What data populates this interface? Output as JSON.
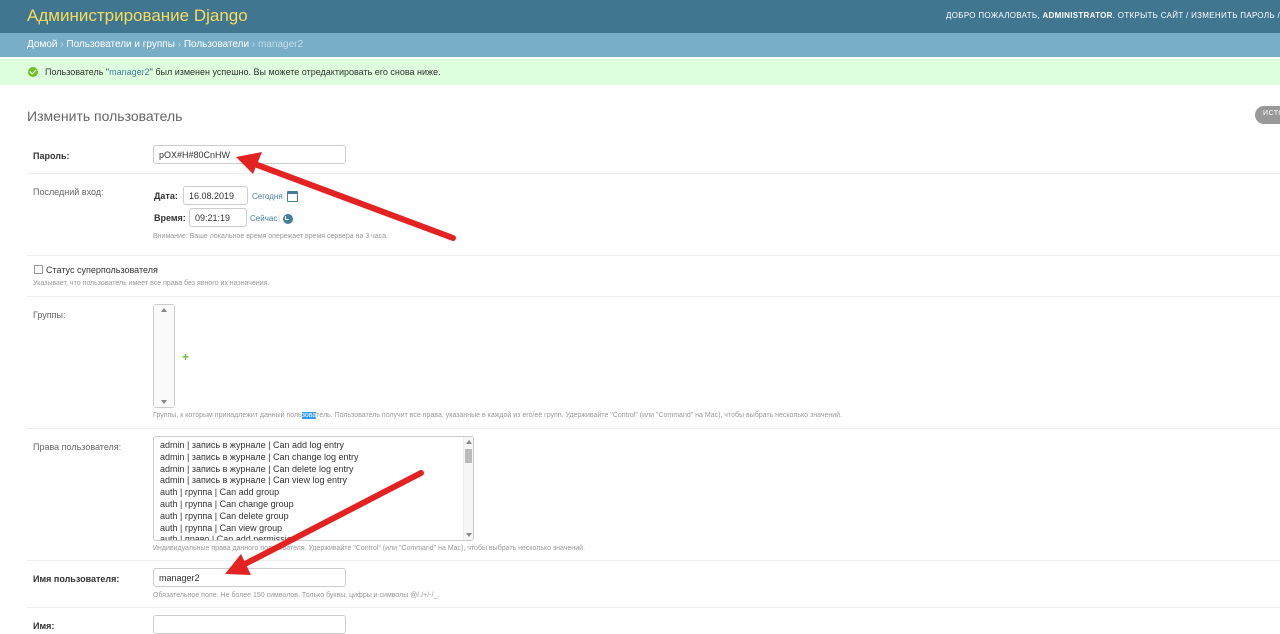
{
  "header": {
    "brand": "Администрирование Django",
    "welcome": "ДОБРО ПОЖАЛОВАТЬ,",
    "username": "ADMINISTRATOR",
    "tools": ". ОТКРЫТЬ САЙТ / ИЗМЕНИТЬ ПАРОЛЬ /"
  },
  "breadcrumbs": {
    "home": "Домой",
    "app": "Пользователи и группы",
    "model": "Пользователи",
    "current": "manager2",
    "sep": "›"
  },
  "message": {
    "prefix": "Пользователь \"",
    "link": "manager2",
    "suffix": "\" был изменен успешно. Вы можете отредактировать его снова ниже."
  },
  "page": {
    "title": "Изменить пользователь",
    "history_button": "ИСТО"
  },
  "form": {
    "password": {
      "label": "Пароль:",
      "value": "pOX#H#80CnHW"
    },
    "last_login": {
      "label": "Последний вход:",
      "date_label": "Дата:",
      "date_value": "16.08.2019",
      "today_link": "Сегодня",
      "time_label": "Время:",
      "time_value": "09:21:19",
      "now_link": "Сейчас",
      "sep": "|",
      "help": "Внимание: Ваше локальное время опережает время сервера на 3 часа."
    },
    "superuser": {
      "label": "Статус суперпользователя",
      "help": "Указывает, что пользователь имеет все права без явного их назначения."
    },
    "groups": {
      "label": "Группы:",
      "help_before": "Группы, к которым принадлежит данный поль",
      "help_highlight": "зова",
      "help_after": "тель. Пользователь получит все права, указанные в каждой из его/её групп. Удерживайте \"Control\" (или \"Command\" на Mac), чтобы выбрать несколько значений."
    },
    "permissions": {
      "label": "Права пользователя:",
      "options": [
        "admin | запись в журнале | Can add log entry",
        "admin | запись в журнале | Can change log entry",
        "admin | запись в журнале | Can delete log entry",
        "admin | запись в журнале | Can view log entry",
        "auth | группа | Can add group",
        "auth | группа | Can change group",
        "auth | группа | Can delete group",
        "auth | группа | Can view group",
        "auth | право | Can add permission"
      ],
      "help": "Индивидуальные права данного пользователя. Удерживайте \"Control\" (или \"Command\" на Mac), чтобы выбрать несколько значений."
    },
    "username": {
      "label": "Имя пользователя:",
      "value": "manager2",
      "help": "Обязательное поле. Не более 150 символов. Только буквы, цифры и символы @/./+/-/_."
    },
    "first_name": {
      "label": "Имя:",
      "value": ""
    }
  },
  "icons": {
    "success": "checkmark-circle-icon",
    "calendar": "calendar-icon",
    "clock": "clock-icon",
    "add": "plus-icon",
    "annotation": "red-arrow"
  },
  "colors": {
    "header_bg": "#417690",
    "brand": "#f5dd5d",
    "breadcrumbs_bg": "#79aec8",
    "message_bg": "#dfd",
    "link": "#447e9b",
    "arrow": "#e52222"
  }
}
